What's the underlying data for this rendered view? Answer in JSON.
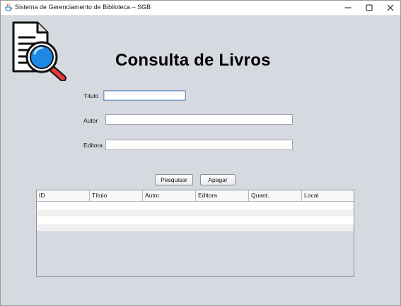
{
  "window": {
    "title": "Sistema de Gerenciamento de Biblioteca – SGB",
    "icon": "java-cup-icon",
    "controls": [
      "minimize-icon",
      "maximize-icon",
      "close-icon"
    ]
  },
  "logo": {
    "icon": "document-search-icon"
  },
  "page": {
    "title": "Consulta de Livros"
  },
  "form": {
    "titulo": {
      "label": "Título",
      "value": "",
      "placeholder": ""
    },
    "autor": {
      "label": "Autor",
      "value": "",
      "placeholder": ""
    },
    "editora": {
      "label": "Editora",
      "value": "",
      "placeholder": ""
    }
  },
  "buttons": {
    "pesquisar": "Pesquisar",
    "apagar": "Apagar"
  },
  "table": {
    "columns": [
      "ID",
      "Título",
      "Autor",
      "Editora",
      "Quant.",
      "Local"
    ],
    "rows": []
  },
  "colors": {
    "window_bg": "#d6d9df",
    "focus_border": "#7a9cc6",
    "logo_lens": "#1e88e5",
    "logo_handle": "#e53935"
  }
}
